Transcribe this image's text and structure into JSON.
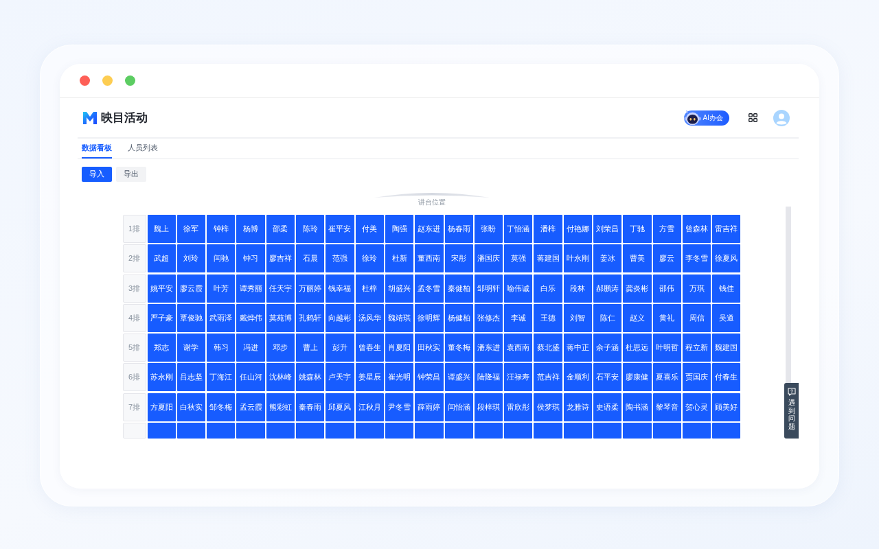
{
  "app": {
    "title": "映目活动",
    "ai_button": "AI办会"
  },
  "tabs": [
    {
      "label": "数据看板",
      "selected": true
    },
    {
      "label": "人员列表",
      "selected": false
    }
  ],
  "toolbar": {
    "buttons": [
      {
        "label": "导入",
        "kind": "primary"
      },
      {
        "label": "导出",
        "kind": "secondary"
      }
    ]
  },
  "seat_map": {
    "stage_label": "讲台位置",
    "rows": [
      {
        "label": "1排",
        "seats": [
          {
            "name": "魏上",
            "occupied": true
          },
          {
            "name": "徐军",
            "occupied": true
          },
          {
            "name": "钟梓",
            "occupied": true
          },
          {
            "name": "杨博",
            "occupied": true
          },
          {
            "name": "邵柔",
            "occupied": true
          },
          {
            "name": "陈玲",
            "occupied": true
          },
          {
            "name": "崔平安",
            "occupied": true
          },
          {
            "name": "付美",
            "occupied": true
          },
          {
            "name": "陶强",
            "occupied": true
          },
          {
            "name": "赵东进",
            "occupied": true
          },
          {
            "name": "杨春雨",
            "occupied": true
          },
          {
            "name": "张盼",
            "occupied": true
          },
          {
            "name": "丁怡涵",
            "occupied": true
          },
          {
            "name": "潘梓",
            "occupied": true
          },
          {
            "name": "付艳娜",
            "occupied": true
          },
          {
            "name": "刘荣昌",
            "occupied": true
          },
          {
            "name": "丁驰",
            "occupied": true
          },
          {
            "name": "方雪",
            "occupied": true
          },
          {
            "name": "曾森林",
            "occupied": true
          },
          {
            "name": "雷吉祥",
            "occupied": true
          }
        ]
      },
      {
        "label": "2排",
        "seats": [
          {
            "name": "武超",
            "occupied": true
          },
          {
            "name": "刘玲",
            "occupied": true
          },
          {
            "name": "闫驰",
            "occupied": true
          },
          {
            "name": "钟习",
            "occupied": true
          },
          {
            "name": "廖吉祥",
            "occupied": true
          },
          {
            "name": "石晨",
            "occupied": true
          },
          {
            "name": "范强",
            "occupied": true
          },
          {
            "name": "徐玲",
            "occupied": true
          },
          {
            "name": "杜新",
            "occupied": true
          },
          {
            "name": "董西南",
            "occupied": true
          },
          {
            "name": "宋彤",
            "occupied": true
          },
          {
            "name": "潘国庆",
            "occupied": true
          },
          {
            "name": "莫强",
            "occupied": true
          },
          {
            "name": "蒋建国",
            "occupied": true
          },
          {
            "name": "叶永刚",
            "occupied": true
          },
          {
            "name": "姜冰",
            "occupied": true
          },
          {
            "name": "曹美",
            "occupied": true
          },
          {
            "name": "廖云",
            "occupied": true
          },
          {
            "name": "李冬雪",
            "occupied": true
          },
          {
            "name": "徐夏风",
            "occupied": true
          }
        ]
      },
      {
        "label": "3排",
        "seats": [
          {
            "name": "姚平安",
            "occupied": true
          },
          {
            "name": "廖云霞",
            "occupied": true
          },
          {
            "name": "叶芳",
            "occupied": true
          },
          {
            "name": "谭秀丽",
            "occupied": true
          },
          {
            "name": "任天宇",
            "occupied": true
          },
          {
            "name": "万丽婷",
            "occupied": true
          },
          {
            "name": "钱幸福",
            "occupied": true
          },
          {
            "name": "杜梓",
            "occupied": true
          },
          {
            "name": "胡盛兴",
            "occupied": true
          },
          {
            "name": "孟冬雪",
            "occupied": true
          },
          {
            "name": "秦健柏",
            "occupied": true
          },
          {
            "name": "邹明轩",
            "occupied": true
          },
          {
            "name": "喻伟诚",
            "occupied": true
          },
          {
            "name": "白乐",
            "occupied": true
          },
          {
            "name": "段林",
            "occupied": true
          },
          {
            "name": "郝鹏涛",
            "occupied": true
          },
          {
            "name": "龚炎彬",
            "occupied": true
          },
          {
            "name": "邵伟",
            "occupied": true
          },
          {
            "name": "万琪",
            "occupied": true
          },
          {
            "name": "钱佳",
            "occupied": true
          }
        ]
      },
      {
        "label": "4排",
        "seats": [
          {
            "name": "严子豪",
            "occupied": true
          },
          {
            "name": "覃俊驰",
            "occupied": true
          },
          {
            "name": "武雨泽",
            "occupied": true
          },
          {
            "name": "戴烨伟",
            "occupied": true
          },
          {
            "name": "莫苑博",
            "occupied": true
          },
          {
            "name": "孔鹤轩",
            "occupied": true
          },
          {
            "name": "向越彬",
            "occupied": true
          },
          {
            "name": "汤风华",
            "occupied": true
          },
          {
            "name": "魏靖琪",
            "occupied": true
          },
          {
            "name": "徐明辉",
            "occupied": true
          },
          {
            "name": "杨健柏",
            "occupied": true
          },
          {
            "name": "张修杰",
            "occupied": true
          },
          {
            "name": "李诚",
            "occupied": true
          },
          {
            "name": "王德",
            "occupied": true
          },
          {
            "name": "刘智",
            "occupied": true
          },
          {
            "name": "陈仁",
            "occupied": true
          },
          {
            "name": "赵义",
            "occupied": true
          },
          {
            "name": "黄礼",
            "occupied": true
          },
          {
            "name": "周信",
            "occupied": true
          },
          {
            "name": "吴道",
            "occupied": true
          }
        ]
      },
      {
        "label": "5排",
        "seats": [
          {
            "name": "郑志",
            "occupied": true
          },
          {
            "name": "谢学",
            "occupied": true
          },
          {
            "name": "韩习",
            "occupied": true
          },
          {
            "name": "冯进",
            "occupied": true
          },
          {
            "name": "邓步",
            "occupied": true
          },
          {
            "name": "曹上",
            "occupied": true
          },
          {
            "name": "彭升",
            "occupied": true
          },
          {
            "name": "曾春生",
            "occupied": true
          },
          {
            "name": "肖夏阳",
            "occupied": true
          },
          {
            "name": "田秋实",
            "occupied": true
          },
          {
            "name": "董冬梅",
            "occupied": true
          },
          {
            "name": "潘东进",
            "occupied": true
          },
          {
            "name": "袁西南",
            "occupied": true
          },
          {
            "name": "蔡北盛",
            "occupied": true
          },
          {
            "name": "蒋中正",
            "occupied": true
          },
          {
            "name": "余子涵",
            "occupied": true
          },
          {
            "name": "杜思远",
            "occupied": true
          },
          {
            "name": "叶明哲",
            "occupied": true
          },
          {
            "name": "程立新",
            "occupied": true
          },
          {
            "name": "魏建国",
            "occupied": true
          }
        ]
      },
      {
        "label": "6排",
        "seats": [
          {
            "name": "苏永刚",
            "occupied": true
          },
          {
            "name": "吕志坚",
            "occupied": true
          },
          {
            "name": "丁海江",
            "occupied": true
          },
          {
            "name": "任山河",
            "occupied": true
          },
          {
            "name": "沈林峰",
            "occupied": true
          },
          {
            "name": "姚森林",
            "occupied": true
          },
          {
            "name": "卢天宇",
            "occupied": true
          },
          {
            "name": "姜星辰",
            "occupied": true
          },
          {
            "name": "崔光明",
            "occupied": true
          },
          {
            "name": "钟荣昌",
            "occupied": true
          },
          {
            "name": "谭盛兴",
            "occupied": true
          },
          {
            "name": "陆隆福",
            "occupied": true
          },
          {
            "name": "汪禄寿",
            "occupied": true
          },
          {
            "name": "范吉祥",
            "occupied": true
          },
          {
            "name": "金顺利",
            "occupied": true
          },
          {
            "name": "石平安",
            "occupied": true
          },
          {
            "name": "廖康健",
            "occupied": true
          },
          {
            "name": "夏喜乐",
            "occupied": true
          },
          {
            "name": "贾国庆",
            "occupied": true
          },
          {
            "name": "付春生",
            "occupied": true
          }
        ]
      },
      {
        "label": "7排",
        "seats": [
          {
            "name": "方夏阳",
            "occupied": true
          },
          {
            "name": "白秋实",
            "occupied": true
          },
          {
            "name": "邹冬梅",
            "occupied": true
          },
          {
            "name": "孟云霞",
            "occupied": true
          },
          {
            "name": "熊彩虹",
            "occupied": true
          },
          {
            "name": "秦春雨",
            "occupied": true
          },
          {
            "name": "邱夏风",
            "occupied": true
          },
          {
            "name": "江秋月",
            "occupied": true
          },
          {
            "name": "尹冬雪",
            "occupied": true
          },
          {
            "name": "薛雨婷",
            "occupied": true
          },
          {
            "name": "闫怡涵",
            "occupied": true
          },
          {
            "name": "段梓琪",
            "occupied": true
          },
          {
            "name": "雷欣彤",
            "occupied": true
          },
          {
            "name": "侯梦琪",
            "occupied": true
          },
          {
            "name": "龙雅诗",
            "occupied": true
          },
          {
            "name": "史语柔",
            "occupied": true
          },
          {
            "name": "陶书涵",
            "occupied": true
          },
          {
            "name": "黎琴音",
            "occupied": true
          },
          {
            "name": "贺心灵",
            "occupied": true
          },
          {
            "name": "顾美好",
            "occupied": true
          }
        ]
      },
      {
        "seats": [
          {
            "occupied": true
          },
          {
            "occupied": true
          },
          {
            "occupied": true
          },
          {
            "occupied": true
          },
          {
            "occupied": true
          },
          {
            "occupied": true
          },
          {
            "occupied": true
          },
          {
            "occupied": true
          },
          {
            "occupied": true
          },
          {
            "occupied": true
          },
          {
            "occupied": true
          },
          {
            "occupied": true
          },
          {
            "occupied": true
          },
          {
            "occupied": true
          },
          {
            "occupied": true
          },
          {
            "occupied": true
          },
          {
            "occupied": true
          },
          {
            "occupied": true
          },
          {
            "occupied": true
          },
          {
            "occupied": true
          }
        ]
      }
    ]
  },
  "help_button": {
    "label": "遇到问题"
  }
}
